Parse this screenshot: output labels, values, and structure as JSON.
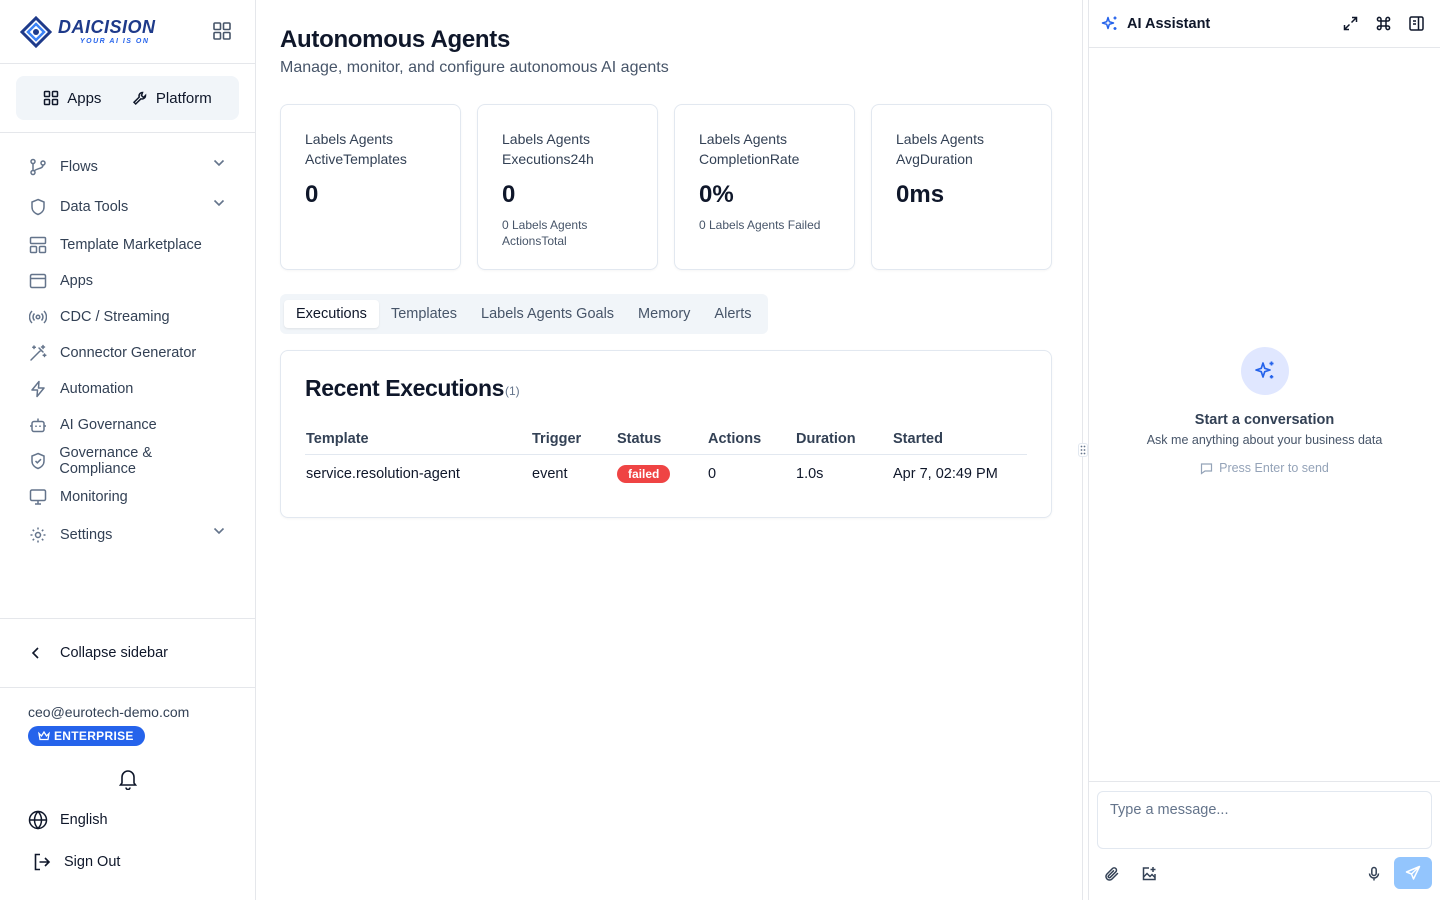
{
  "brand": {
    "name": "DAICISION",
    "tagline": "YOUR AI IS ON"
  },
  "switcher": {
    "apps_label": "Apps",
    "platform_label": "Platform"
  },
  "sidebar": {
    "items": [
      {
        "label": "Flows"
      },
      {
        "label": "Data Tools"
      },
      {
        "label": "Template Marketplace"
      },
      {
        "label": "Apps"
      },
      {
        "label": "CDC / Streaming"
      },
      {
        "label": "Connector Generator"
      },
      {
        "label": "Automation"
      },
      {
        "label": "AI Governance"
      },
      {
        "label": "Governance & Compliance"
      },
      {
        "label": "Monitoring"
      },
      {
        "label": "Settings"
      }
    ],
    "collapse_label": "Collapse sidebar",
    "email": "ceo@eurotech-demo.com",
    "plan_badge": "ENTERPRISE",
    "language": "English",
    "sign_out": "Sign Out"
  },
  "page": {
    "title": "Autonomous Agents",
    "subtitle": "Manage, monitor, and configure autonomous AI agents"
  },
  "cards": [
    {
      "label": "Labels Agents ActiveTemplates",
      "value": "0",
      "note": ""
    },
    {
      "label": "Labels Agents Executions24h",
      "value": "0",
      "note": "0 Labels Agents ActionsTotal"
    },
    {
      "label": "Labels Agents CompletionRate",
      "value": "0%",
      "note": "0 Labels Agents Failed"
    },
    {
      "label": "Labels Agents AvgDuration",
      "value": "0ms",
      "note": ""
    }
  ],
  "tabs": [
    "Executions",
    "Templates",
    "Labels Agents Goals",
    "Memory",
    "Alerts"
  ],
  "executions": {
    "title": "Recent Executions",
    "count": "(1)",
    "columns": [
      "Template",
      "Trigger",
      "Status",
      "Actions",
      "Duration",
      "Started"
    ],
    "rows": [
      {
        "template": "service.resolution-agent",
        "trigger": "event",
        "status": "failed",
        "actions": "0",
        "duration": "1.0s",
        "started": "Apr 7, 02:49 PM"
      }
    ]
  },
  "assistant": {
    "title": "AI Assistant",
    "empty_title": "Start a conversation",
    "empty_subtitle": "Ask me anything about your business data",
    "hint": "Press Enter to send",
    "input_placeholder": "Type a message..."
  },
  "colors": {
    "accent": "#2563eb",
    "failed": "#ef4444",
    "send": "#93c5fd"
  },
  "icons": {
    "flows": "git-branch-icon",
    "data_tools": "shield-icon",
    "template_marketplace": "layout-icon",
    "apps": "window-icon",
    "cdc": "radio-icon",
    "connector": "wand-icon",
    "automation": "zap-icon",
    "ai_governance": "bot-icon",
    "governance": "shield-check-icon",
    "monitoring": "monitor-icon",
    "settings": "gear-icon"
  }
}
